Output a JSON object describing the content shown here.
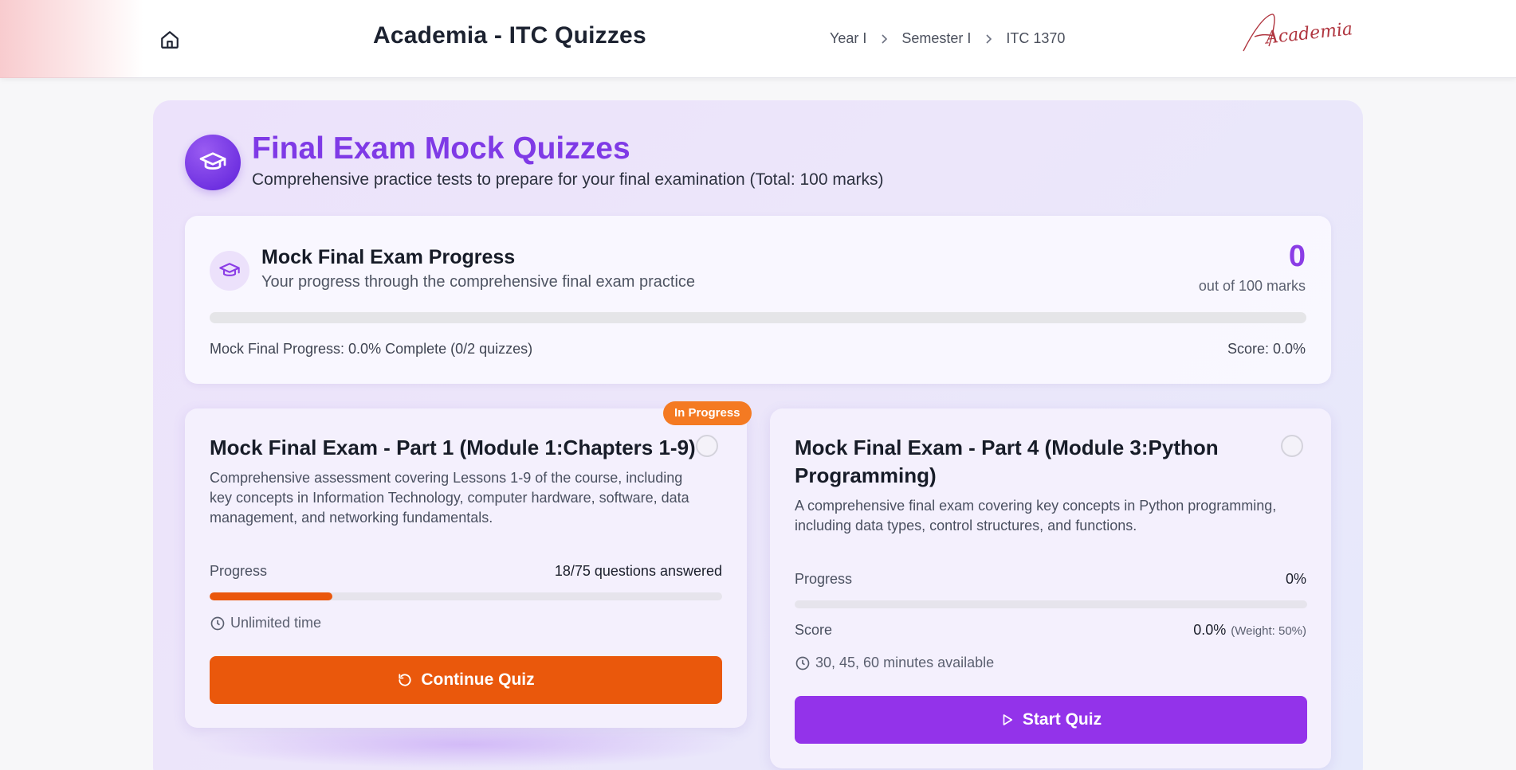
{
  "header": {
    "title": "Academia - ITC Quizzes",
    "breadcrumb": [
      "Year I",
      "Semester I",
      "ITC 1370"
    ],
    "logo_text": "Academia"
  },
  "hero": {
    "title": "Final Exam Mock Quizzes",
    "subtitle": "Comprehensive practice tests to prepare for your final examination (Total: 100 marks)"
  },
  "summary": {
    "title": "Mock Final Exam Progress",
    "description": "Your progress through the comprehensive final exam practice",
    "score": "0",
    "score_sub": "out of 100 marks",
    "progress_fraction": 0,
    "footer_left": "Mock Final Progress: 0.0% Complete (0/2 quizzes)",
    "footer_right": "Score: 0.0%"
  },
  "quizzes": [
    {
      "badge": "In Progress",
      "title": "Mock Final Exam - Part 1 (Module 1:Chapters 1-9)",
      "description": "Comprehensive assessment covering Lessons 1-9 of the course, including key concepts in Information Technology, computer hardware, software, data management, and networking fundamentals.",
      "progress_label": "Progress",
      "progress_value": "18/75 questions answered",
      "progress_fraction": 0.24,
      "time": "Unlimited time",
      "button": "Continue Quiz",
      "accent": "#ea580c"
    },
    {
      "title": "Mock Final Exam - Part 4 (Module 3:Python Programming)",
      "description": "A comprehensive final exam covering key concepts in Python programming, including data types, control structures, and functions.",
      "progress_label": "Progress",
      "progress_value": "0%",
      "progress_fraction": 0,
      "score_label": "Score",
      "score_value": "0.0%",
      "score_weight": "(Weight: 50%)",
      "time": "30, 45, 60 minutes available",
      "button": "Start Quiz",
      "accent": "#9333ea"
    }
  ],
  "colors": {
    "brand_purple": "#8b3de6",
    "orange": "#ea580c",
    "badge_orange": "#f47a22"
  },
  "icons": [
    "home-icon",
    "chevron-right-icon",
    "graduation-cap-icon",
    "clock-icon",
    "refresh-icon",
    "play-icon"
  ]
}
